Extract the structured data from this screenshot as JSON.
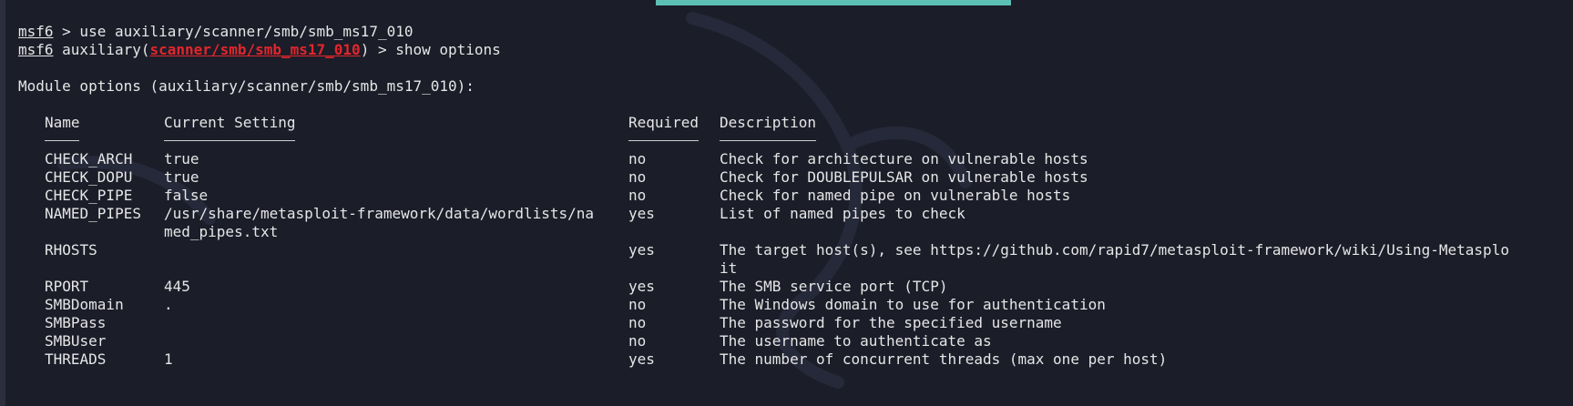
{
  "terminal": {
    "prompt": "msf6",
    "cmd1_rest": " > use auxiliary/scanner/smb/smb_ms17_010",
    "cmd2_mid": " auxiliary(",
    "cmd2_module": "scanner/smb/smb_ms17_010",
    "cmd2_rest": ") > show options",
    "module_heading": "Module options (auxiliary/scanner/smb/smb_ms17_010):",
    "colors": {
      "background": "#1b1d29",
      "text": "#e6e6e6",
      "module_red": "#e3262b",
      "selection": "#5cc0b4"
    },
    "watermark_icon": "kali-dragon-icon"
  },
  "table": {
    "headers": [
      "Name",
      "Current Setting",
      "Required",
      "Description"
    ],
    "rows": [
      {
        "name": "CHECK_ARCH",
        "setting": [
          "true"
        ],
        "required": "no",
        "description": [
          "Check for architecture on vulnerable hosts"
        ]
      },
      {
        "name": "CHECK_DOPU",
        "setting": [
          "true"
        ],
        "required": "no",
        "description": [
          "Check for DOUBLEPULSAR on vulnerable hosts"
        ]
      },
      {
        "name": "CHECK_PIPE",
        "setting": [
          "false"
        ],
        "required": "no",
        "description": [
          "Check for named pipe on vulnerable hosts"
        ]
      },
      {
        "name": "NAMED_PIPES",
        "setting": [
          "/usr/share/metasploit-framework/data/wordlists/na",
          "med_pipes.txt"
        ],
        "required": "yes",
        "description": [
          "List of named pipes to check"
        ]
      },
      {
        "name": "RHOSTS",
        "setting": [
          ""
        ],
        "required": "yes",
        "description": [
          "The target host(s), see https://github.com/rapid7/metasploit-framework/wiki/Using-Metasplo",
          "it"
        ]
      },
      {
        "name": "RPORT",
        "setting": [
          "445"
        ],
        "required": "yes",
        "description": [
          "The SMB service port (TCP)"
        ]
      },
      {
        "name": "SMBDomain",
        "setting": [
          "."
        ],
        "required": "no",
        "description": [
          "The Windows domain to use for authentication"
        ]
      },
      {
        "name": "SMBPass",
        "setting": [
          ""
        ],
        "required": "no",
        "description": [
          "The password for the specified username"
        ]
      },
      {
        "name": "SMBUser",
        "setting": [
          ""
        ],
        "required": "no",
        "description": [
          "The username to authenticate as"
        ]
      },
      {
        "name": "THREADS",
        "setting": [
          "1"
        ],
        "required": "yes",
        "description": [
          "The number of concurrent threads (max one per host)"
        ]
      }
    ]
  }
}
